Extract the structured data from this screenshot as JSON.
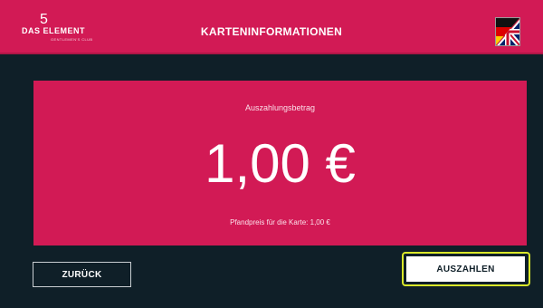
{
  "header": {
    "logo": {
      "numeral": "5",
      "brand": "DAS ELEMENT",
      "tagline": "GENTLEMEN'S CLUB"
    },
    "title": "KARTENINFORMATIONEN",
    "language_icon": "german-british-flag-icon"
  },
  "panel": {
    "amount_label": "Auszahlungsbetrag",
    "amount": "1,00 €",
    "deposit_text": "Pfandpreis für die Karte: 1,00 €"
  },
  "buttons": {
    "back_label": "ZURÜCK",
    "payout_label": "AUSZAHLEN"
  },
  "colors": {
    "accent": "#d21a55",
    "background": "#0f1f28",
    "focus": "#d9e82a"
  }
}
